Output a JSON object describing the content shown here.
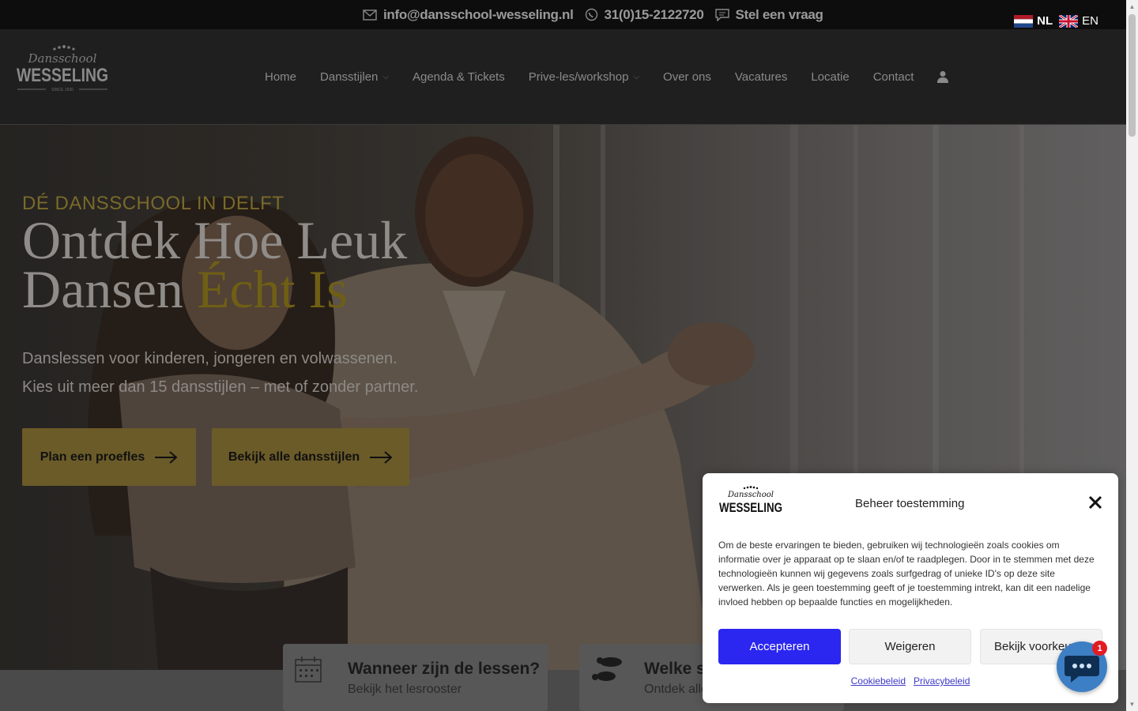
{
  "topbar": {
    "email": "info@dansschool-wesseling.nl",
    "phone": "31(0)15-2122720",
    "question": "Stel een vraag",
    "languages": [
      {
        "code": "NL",
        "active": true
      },
      {
        "code": "EN",
        "active": false
      }
    ]
  },
  "header": {
    "logo": {
      "script": "Dansschool",
      "name": "WESSELING",
      "since": "SINCE 1930"
    },
    "nav": [
      {
        "label": "Home"
      },
      {
        "label": "Dansstijlen",
        "dropdown": true
      },
      {
        "label": "Agenda & Tickets"
      },
      {
        "label": "Prive-les/workshop",
        "dropdown": true
      },
      {
        "label": "Over ons"
      },
      {
        "label": "Vacatures"
      },
      {
        "label": "Locatie"
      },
      {
        "label": "Contact"
      }
    ]
  },
  "hero": {
    "kicker": "DÉ DANSSCHOOL IN DELFT",
    "title_line1": "Ontdek Hoe Leuk",
    "title_line2_a": "Dansen ",
    "title_line2_b": "Écht Is",
    "sub_line1": "Danslessen voor kinderen, jongeren en volwassenen.",
    "sub_line2": "Kies uit meer dan 15 dansstijlen – met of zonder partner.",
    "btn_trial": "Plan een proefles",
    "btn_styles": "Bekijk alle dansstijlen"
  },
  "cards": [
    {
      "title": "Wanneer zijn de lessen?",
      "sub": "Bekijk het lesrooster"
    },
    {
      "title": "Welke st",
      "sub": "Ontdek alle"
    }
  ],
  "cookie": {
    "logo_script": "Dansschool",
    "logo_name": "WESSELING",
    "title": "Beheer toestemming",
    "text": "Om de beste ervaringen te bieden, gebruiken wij technologieën zoals cookies om informatie over je apparaat op te slaan en/of te raadplegen. Door in te stemmen met deze technologieën kunnen wij gegevens zoals surfgedrag of unieke ID's op deze site verwerken. Als je geen toestemming geeft of je toestemming intrekt, kan dit een nadelige invloed hebben op bepaalde functies en mogelijkheden.",
    "accept": "Accepteren",
    "deny": "Weigeren",
    "prefs": "Bekijk voorkeuren",
    "link_cookie": "Cookiebeleid",
    "link_privacy": "Privacybeleid"
  },
  "chat": {
    "badge": "1"
  },
  "colors": {
    "accent_gold": "#6b5b28",
    "accept_blue": "#2b26f0",
    "chat_blue": "#3d7fc4"
  }
}
